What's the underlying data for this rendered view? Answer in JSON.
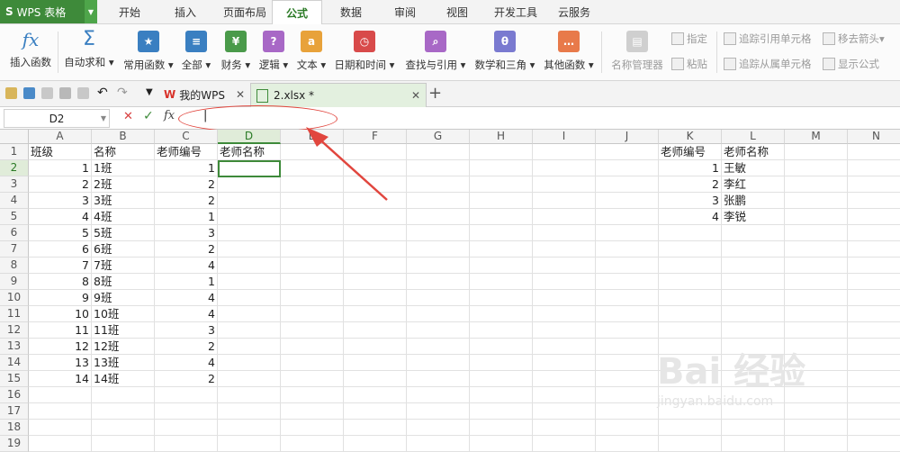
{
  "app": {
    "title": "WPS 表格",
    "logo": "S"
  },
  "menu_tabs": [
    "开始",
    "插入",
    "页面布局",
    "公式",
    "数据",
    "审阅",
    "视图",
    "开发工具",
    "云服务"
  ],
  "active_menu_tab": "公式",
  "ribbon": {
    "insert_function": "插入函数",
    "autosum": "自动求和",
    "common": "常用函数",
    "all": "全部",
    "finance": "财务",
    "logic": "逻辑",
    "text": "文本",
    "datetime": "日期和时间",
    "lookup": "查找与引用",
    "math": "数学和三角",
    "other": "其他函数",
    "name_manager": "名称管理器",
    "specify": "指定",
    "paste": "粘贴",
    "trace_precedents": "追踪引用单元格",
    "trace_dependents": "追踪从属单元格",
    "remove_arrows": "移去箭头",
    "show_formulas": "显示公式"
  },
  "doc_tabs": [
    {
      "label": "我的WPS"
    },
    {
      "label": "2.xlsx *"
    }
  ],
  "formula_bar": {
    "name_box": "D2",
    "fx": "fx",
    "cancel": "✕",
    "confirm": "✓",
    "content": "|"
  },
  "columns": [
    "A",
    "B",
    "C",
    "D",
    "E",
    "F",
    "G",
    "H",
    "I",
    "J",
    "K",
    "L",
    "M",
    "N"
  ],
  "selected_column": "D",
  "rows": [
    "1",
    "2",
    "3",
    "4",
    "5",
    "6",
    "7",
    "8",
    "9",
    "10",
    "11",
    "12",
    "13",
    "14",
    "15",
    "16",
    "17",
    "18",
    "19"
  ],
  "selected_row": "2",
  "headers": {
    "A": "班级",
    "B": "名称",
    "C": "老师编号",
    "D": "老师名称",
    "K": "老师编号",
    "L": "老师名称"
  },
  "table_left": [
    {
      "A": "1",
      "B": "1班",
      "C": "1"
    },
    {
      "A": "2",
      "B": "2班",
      "C": "2"
    },
    {
      "A": "3",
      "B": "3班",
      "C": "2"
    },
    {
      "A": "4",
      "B": "4班",
      "C": "1"
    },
    {
      "A": "5",
      "B": "5班",
      "C": "3"
    },
    {
      "A": "6",
      "B": "6班",
      "C": "2"
    },
    {
      "A": "7",
      "B": "7班",
      "C": "4"
    },
    {
      "A": "8",
      "B": "8班",
      "C": "1"
    },
    {
      "A": "9",
      "B": "9班",
      "C": "4"
    },
    {
      "A": "10",
      "B": "10班",
      "C": "4"
    },
    {
      "A": "11",
      "B": "11班",
      "C": "3"
    },
    {
      "A": "12",
      "B": "12班",
      "C": "2"
    },
    {
      "A": "13",
      "B": "13班",
      "C": "4"
    },
    {
      "A": "14",
      "B": "14班",
      "C": "2"
    }
  ],
  "table_right": [
    {
      "K": "1",
      "L": "王敏"
    },
    {
      "K": "2",
      "L": "李红"
    },
    {
      "K": "3",
      "L": "张鹏"
    },
    {
      "K": "4",
      "L": "李锐"
    }
  ],
  "watermark": {
    "main": "Bai 经验",
    "sub": "jingyan.baidu.com"
  },
  "colors": {
    "accent": "#3e8a3a",
    "annotation": "#e1463e"
  }
}
